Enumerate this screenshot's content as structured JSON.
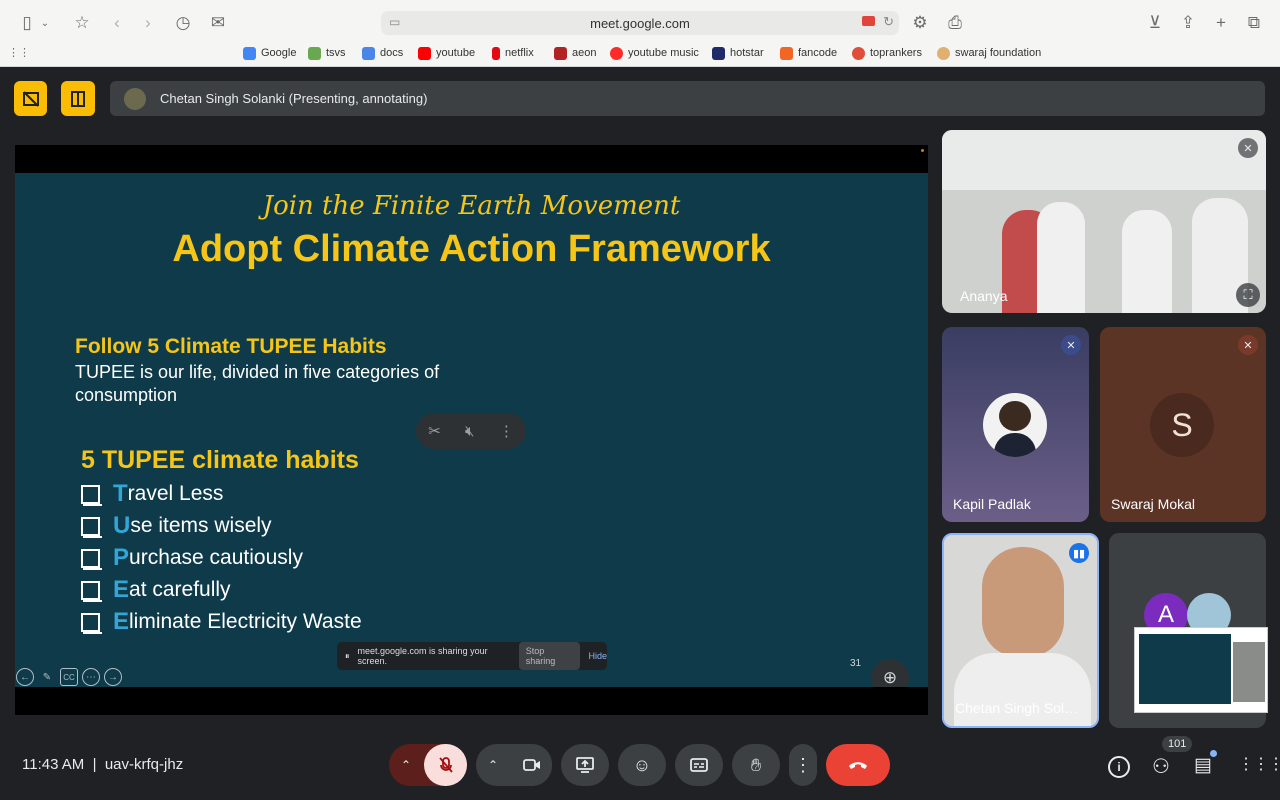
{
  "browser": {
    "url": "meet.google.com",
    "bookmarks": [
      {
        "label": "Google",
        "color": "#4285f4"
      },
      {
        "label": "tsvs",
        "color": "#6aa84f"
      },
      {
        "label": "docs",
        "color": "#4a86e8"
      },
      {
        "label": "youtube",
        "color": "#ff0000"
      },
      {
        "label": "netflix",
        "color": "#e50914"
      },
      {
        "label": "aeon",
        "color": "#b22222"
      },
      {
        "label": "youtube music",
        "color": "#ff2a2a"
      },
      {
        "label": "hotstar",
        "color": "#1f2a6b"
      },
      {
        "label": "fancode",
        "color": "#f26522"
      },
      {
        "label": "toprankers",
        "color": "#e04e39"
      },
      {
        "label": "swaraj foundation",
        "color": "#e0b070"
      }
    ]
  },
  "meet": {
    "presenter_label": "Chetan Singh Solanki (Presenting, annotating)",
    "time": "11:43 AM",
    "meeting_code": "uav-krfq-jhz",
    "participant_count": "101"
  },
  "slide": {
    "subtitle": "Join the Finite Earth Movement",
    "title": "Adopt Climate Action Framework",
    "heading1": "Follow 5 Climate TUPEE Habits",
    "paragraph": "TUPEE is our life, divided in five categories of consumption",
    "heading2": "5 TUPEE climate habits",
    "habits": [
      {
        "letter": "T",
        "rest": "ravel Less"
      },
      {
        "letter": "U",
        "rest": "se items wisely"
      },
      {
        "letter": "P",
        "rest": "urchase cautiously"
      },
      {
        "letter": "E",
        "rest": "at carefully"
      },
      {
        "letter": "E",
        "rest": "liminate Electricity Waste"
      }
    ],
    "page_number": "31",
    "share_notice": "meet.google.com is sharing your screen.",
    "stop_sharing": "Stop sharing",
    "hide": "Hide"
  },
  "participants": {
    "room": "Ananya",
    "kapil": "Kapil Padlak",
    "swaraj": "Swaraj Mokal",
    "swaraj_initial": "S",
    "chetan": "Chetan Singh Sol…",
    "other_initial": "A"
  },
  "colors": {
    "accent_yellow": "#fbbc04",
    "end_call": "#ea4335",
    "mic_off": "#f28b82"
  }
}
